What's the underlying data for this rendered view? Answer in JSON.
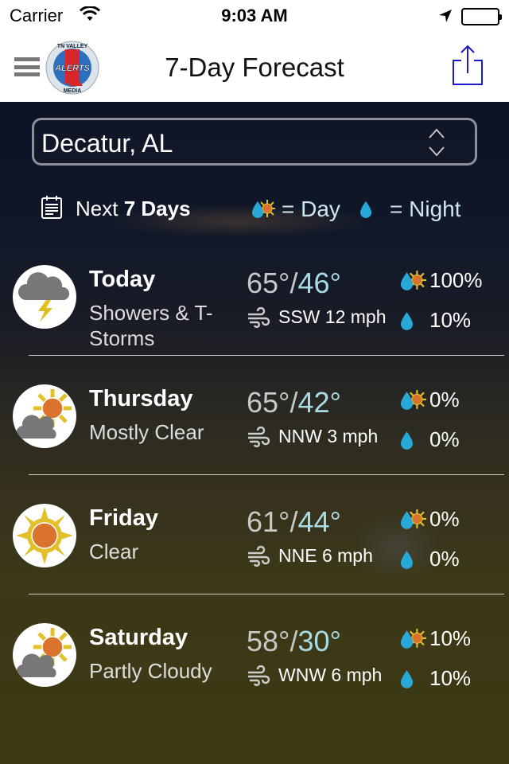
{
  "status_bar": {
    "carrier": "Carrier",
    "time": "9:03 AM",
    "battery_level": 1.0
  },
  "nav": {
    "title": "7-Day Forecast",
    "logo_text": {
      "top": "TN VALLEY",
      "center": "ALERTS",
      "bottom": "MEDIA"
    },
    "share_color": "#1a1acc"
  },
  "location": {
    "selected": "Decatur, AL"
  },
  "subheader": {
    "next_label": "Next",
    "days_label": "7 Days",
    "legend_day": "= Day",
    "legend_night": "= Night"
  },
  "colors": {
    "drop": "#27a8d6",
    "sun_rays": "#e2c02a",
    "sun_core": "#d9732e",
    "cloud": "#777777",
    "bolt": "#e0c020",
    "low_temp": "#a7dbe6"
  },
  "forecast": [
    {
      "day": "Today",
      "condition": "Showers & T-Storms",
      "icon": "thunderstorm-icon",
      "high": "65°",
      "low": "46°",
      "wind": "SSW 12 mph",
      "precip_day": "100%",
      "precip_night": "10%"
    },
    {
      "day": "Thursday",
      "condition": "Mostly Clear",
      "icon": "partly-cloudy-icon",
      "high": "65°",
      "low": "42°",
      "wind": "NNW 3 mph",
      "precip_day": "0%",
      "precip_night": "0%"
    },
    {
      "day": "Friday",
      "condition": "Clear",
      "icon": "sunny-icon",
      "high": "61°",
      "low": "44°",
      "wind": "NNE 6 mph",
      "precip_day": "0%",
      "precip_night": "0%"
    },
    {
      "day": "Saturday",
      "condition": "Partly Cloudy",
      "icon": "partly-cloudy-icon",
      "high": "58°",
      "low": "30°",
      "wind": "WNW 6 mph",
      "precip_day": "10%",
      "precip_night": "10%"
    }
  ]
}
